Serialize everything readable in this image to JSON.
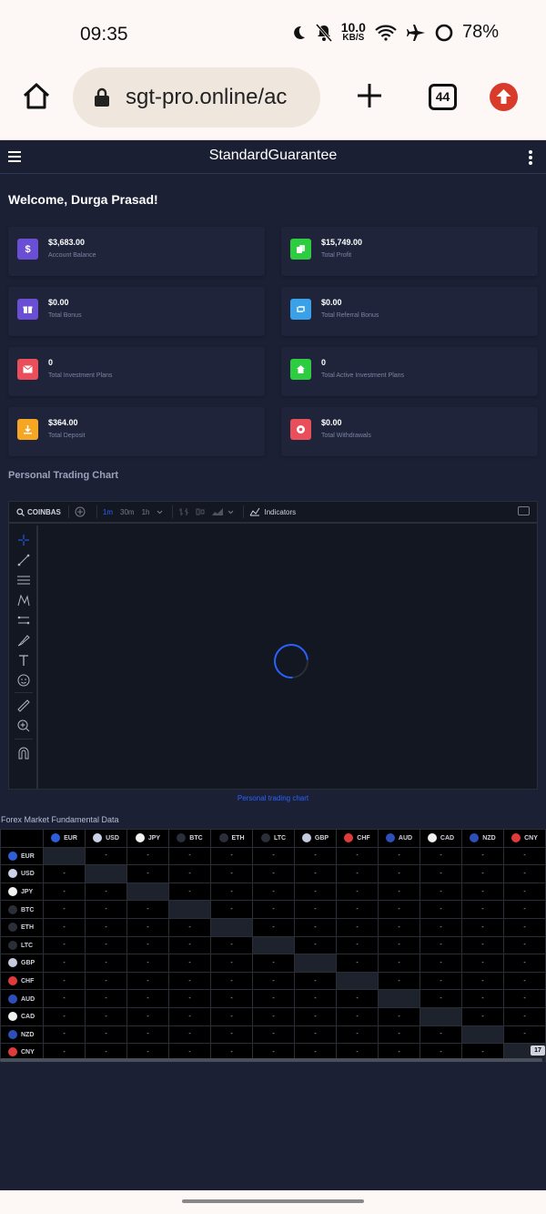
{
  "status_bar": {
    "time": "09:35",
    "speed_value": "10.0",
    "speed_unit": "KB/S",
    "battery": "78%",
    "icons": [
      "moon-icon",
      "bell-off-icon",
      "wifi-icon",
      "airplane-icon",
      "battery-ring-icon"
    ]
  },
  "browser": {
    "url": "sgt-pro.online/ac",
    "tab_count": "44",
    "icons": [
      "home-icon",
      "lock-icon",
      "plus-icon",
      "tab-switcher-icon",
      "update-icon"
    ]
  },
  "site": {
    "title": "StandardGuarantee",
    "welcome": "Welcome, Durga Prasad!"
  },
  "cards": [
    {
      "value": "$3,683.00",
      "label": "Account Balance",
      "icon": "dollar-icon",
      "color": "#6a4fd4"
    },
    {
      "value": "$15,749.00",
      "label": "Total Profit",
      "icon": "copy-icon",
      "color": "#2ecc40"
    },
    {
      "value": "$0.00",
      "label": "Total Bonus",
      "icon": "gift-icon",
      "color": "#6a4fd4"
    },
    {
      "value": "$0.00",
      "label": "Total Referral Bonus",
      "icon": "retweet-icon",
      "color": "#3aa0e8"
    },
    {
      "value": "0",
      "label": "Total Investment Plans",
      "icon": "envelope-icon",
      "color": "#e94e5b"
    },
    {
      "value": "0",
      "label": "Total Active Investment Plans",
      "icon": "home-icon",
      "color": "#2ecc40"
    },
    {
      "value": "$364.00",
      "label": "Total Deposit",
      "icon": "download-icon",
      "color": "#f5a623"
    },
    {
      "value": "$0.00",
      "label": "Total Withdrawals",
      "icon": "upload-icon",
      "color": "#e94e5b"
    }
  ],
  "chart_section": {
    "title": "Personal Trading Chart",
    "symbol": "COINBAS",
    "timeframes": [
      "1m",
      "30m",
      "1h"
    ],
    "active_timeframe": "1m",
    "indicators_label": "Indicators",
    "caption": "Personal trading chart"
  },
  "forex": {
    "title": "Forex Market Fundamental Data",
    "currencies": [
      {
        "code": "EUR",
        "color": "#2d5fd8"
      },
      {
        "code": "USD",
        "color": "#c9d2e6"
      },
      {
        "code": "JPY",
        "color": "#f2f2f2"
      },
      {
        "code": "BTC",
        "color": "#2a2e39"
      },
      {
        "code": "ETH",
        "color": "#2a2e39"
      },
      {
        "code": "LTC",
        "color": "#2a2e39"
      },
      {
        "code": "GBP",
        "color": "#c4cbe0"
      },
      {
        "code": "CHF",
        "color": "#e03b3b"
      },
      {
        "code": "AUD",
        "color": "#2d4fb8"
      },
      {
        "code": "CAD",
        "color": "#f0f0f0"
      },
      {
        "code": "NZD",
        "color": "#2d4fb8"
      },
      {
        "code": "CNY",
        "color": "#e03b3b"
      }
    ],
    "empty_cell": "-",
    "watermark": "17"
  }
}
